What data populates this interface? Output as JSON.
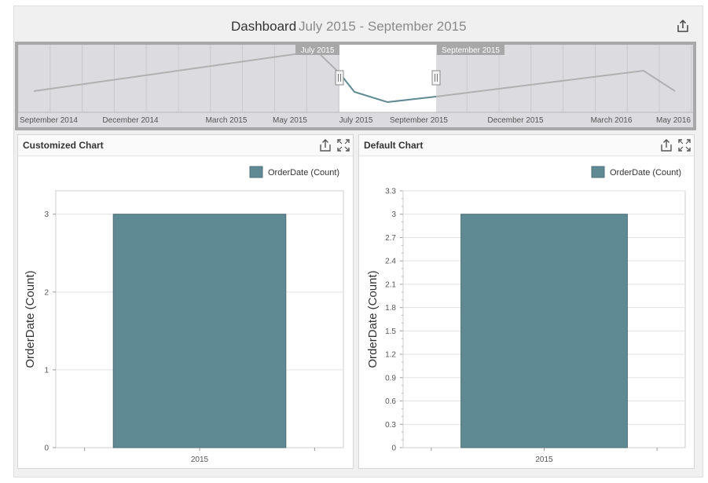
{
  "dashboard": {
    "title": "Dashboard",
    "period": "July 2015 - September 2015",
    "export_icon": "export-icon"
  },
  "range_filter": {
    "labels": [
      "September 2014",
      "December 2014",
      "March 2015",
      "May 2015",
      "July 2015",
      "September 2015",
      "December 2015",
      "March 2016",
      "May 2016"
    ],
    "selection_start": "July 2015",
    "selection_end": "September 2015",
    "line_color": "#b0b0b0",
    "selected_line_color": "#5f8a93"
  },
  "panels": [
    {
      "title": "Customized Chart",
      "icons": [
        "export-icon",
        "maximize-icon"
      ],
      "legend": "OrderDate (Count)",
      "chart_data": {
        "type": "bar",
        "categories": [
          "2015"
        ],
        "series": [
          {
            "name": "OrderDate (Count)",
            "values": [
              3
            ]
          }
        ],
        "ylabel": "OrderDate (Count)",
        "ylim": [
          0,
          3.3
        ],
        "yticks": [
          0,
          1,
          2,
          3
        ],
        "grid": true,
        "legend_position": "top-right",
        "bar_color": "#5f8a93"
      }
    },
    {
      "title": "Default Chart",
      "icons": [
        "export-icon",
        "maximize-icon"
      ],
      "legend": "OrderDate (Count)",
      "chart_data": {
        "type": "bar",
        "categories": [
          "2015"
        ],
        "series": [
          {
            "name": "OrderDate (Count)",
            "values": [
              3
            ]
          }
        ],
        "ylabel": "OrderDate (Count)",
        "ylim": [
          0,
          3.3
        ],
        "yticks": [
          0,
          0.3,
          0.6,
          0.9,
          1.2,
          1.5,
          1.8,
          2.1,
          2.4,
          2.7,
          3,
          3.3
        ],
        "grid": true,
        "legend_position": "top-right",
        "bar_color": "#5f8a93"
      }
    }
  ]
}
